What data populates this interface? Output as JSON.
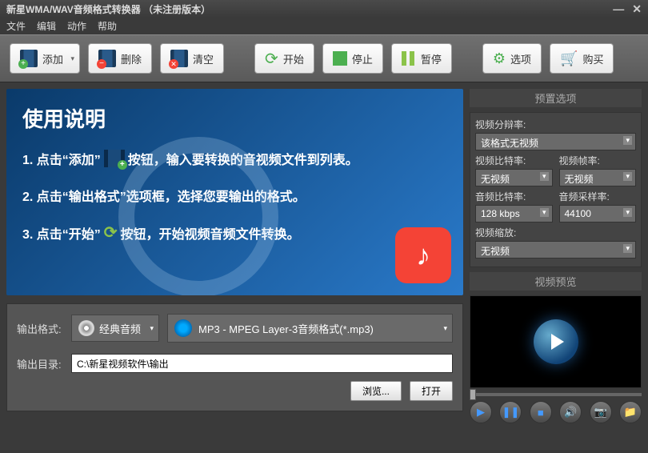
{
  "window": {
    "title": "新星WMA/WAV音频格式转换器  （未注册版本）"
  },
  "menu": {
    "file": "文件",
    "edit": "编辑",
    "action": "动作",
    "help": "帮助"
  },
  "toolbar": {
    "add": "添加",
    "delete": "删除",
    "clear": "清空",
    "start": "开始",
    "stop": "停止",
    "pause": "暂停",
    "options": "选项",
    "buy": "购买"
  },
  "instructions": {
    "title": "使用说明",
    "step1a": "1. 点击“添加”",
    "step1b": "按钮，输入要转换的音视频文件到列表。",
    "step2": "2. 点击“输出格式”选项框，选择您要输出的格式。",
    "step3a": "3. 点击“开始”",
    "step3b": "按钮，开始视频音频文件转换。"
  },
  "output": {
    "format_label": "输出格式:",
    "category": "经典音频",
    "format": "MP3 - MPEG Layer-3音频格式(*.mp3)",
    "dir_label": "输出目录:",
    "dir_value": "C:\\新星视频软件\\输出",
    "browse": "浏览...",
    "open": "打开"
  },
  "presets": {
    "title": "预置选项",
    "resolution_label": "视频分辩率:",
    "resolution": "该格式无视频",
    "vbitrate_label": "视频比特率:",
    "vbitrate": "无视频",
    "vframerate_label": "视频帧率:",
    "vframerate": "无视频",
    "abitrate_label": "音频比特率:",
    "abitrate": "128 kbps",
    "asamplerate_label": "音频采样率:",
    "asamplerate": "44100",
    "zoom_label": "视频缩放:",
    "zoom": "无视频"
  },
  "preview": {
    "title": "视频预览"
  }
}
